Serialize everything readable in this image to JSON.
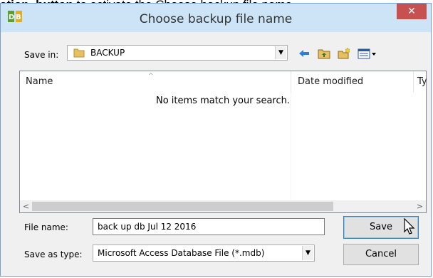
{
  "doc_line": {
    "pre": "ation.",
    "ul": "      ",
    "bold": " button",
    "post": " to activate the Choose backup file name"
  },
  "dialog": {
    "title": "Choose backup file name",
    "close_label": "✕"
  },
  "save_in": {
    "label": "Save in:",
    "value": "BACKUP"
  },
  "toolbar": {
    "back_icon": "⇦",
    "up_icon": "up-folder-icon",
    "new_icon": "new-folder-icon",
    "view_icon": "view-menu-icon"
  },
  "listview": {
    "columns": [
      "Name",
      "Date modified",
      "Ty"
    ],
    "empty_message": "No items match your search.",
    "sort_indicator": "^"
  },
  "file_name": {
    "label": "File name:",
    "value": "back up db Jul 12 2016"
  },
  "save_as_type": {
    "label": "Save as type:",
    "value": "Microsoft Access Database File (*.mdb)"
  },
  "buttons": {
    "save": "Save",
    "cancel": "Cancel"
  },
  "colors": {
    "titlebar": "#cde4f7",
    "close": "#c75050",
    "folder": "#e8c064"
  }
}
